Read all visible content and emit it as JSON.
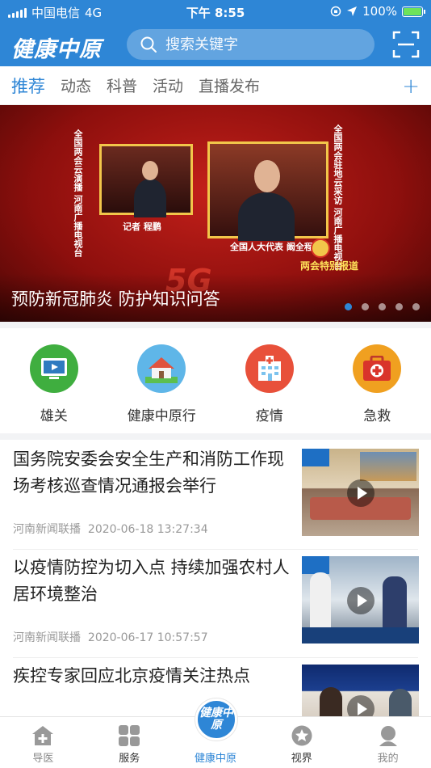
{
  "status_bar": {
    "carrier": "中国电信",
    "network": "4G",
    "time": "下午 8:55",
    "battery": "100%"
  },
  "header": {
    "logo": "健康中原",
    "search_placeholder": "搜索关键字"
  },
  "tabs": [
    {
      "label": "推荐",
      "active": true
    },
    {
      "label": "动态"
    },
    {
      "label": "科普"
    },
    {
      "label": "活动"
    },
    {
      "label": "直播发布"
    }
  ],
  "tab_add": "+",
  "banner": {
    "caption": "预防新冠肺炎 防护知识问答",
    "left_vertical": [
      "全国两会云演播",
      "河南广播电视台"
    ],
    "right_vertical": [
      "全国两会驻地云采访",
      "河南广播电视台"
    ],
    "reporter_label": "记者  程鹏",
    "rep_label": "全国人大代表  阚全程",
    "special_label": "两会特别报道",
    "badge": "5G",
    "slide_count": 5,
    "active_slide": 0
  },
  "shortcuts": [
    {
      "label": "雄关",
      "icon": "video-screen-icon",
      "color": "#3fae3f"
    },
    {
      "label": "健康中原行",
      "icon": "house-icon",
      "color": "#5fb6e8"
    },
    {
      "label": "疫情",
      "icon": "hospital-icon",
      "color": "#e8503a"
    },
    {
      "label": "急救",
      "icon": "first-aid-kit-icon",
      "color": "#f0a020"
    }
  ],
  "news": [
    {
      "title": "国务院安委会安全生产和消防工作现场考核巡查情况通报会举行",
      "source": "河南新闻联播",
      "date": "2020-06-18 13:27:34"
    },
    {
      "title": "以疫情防控为切入点 持续加强农村人居环境整治",
      "source": "河南新闻联播",
      "date": "2020-06-17 10:57:57"
    },
    {
      "title": "疾控专家回应北京疫情关注热点",
      "source": "",
      "date": ""
    }
  ],
  "tabbar": [
    {
      "label": "导医",
      "icon": "home-plus-icon"
    },
    {
      "label": "服务",
      "icon": "grid-icon"
    },
    {
      "label": "健康中原",
      "icon": "logo-icon",
      "active": true
    },
    {
      "label": "视界",
      "icon": "star-circle-icon"
    },
    {
      "label": "我的",
      "icon": "user-icon"
    }
  ],
  "center_logo": "健康中原",
  "colors": {
    "brand": "#2e86d6"
  }
}
